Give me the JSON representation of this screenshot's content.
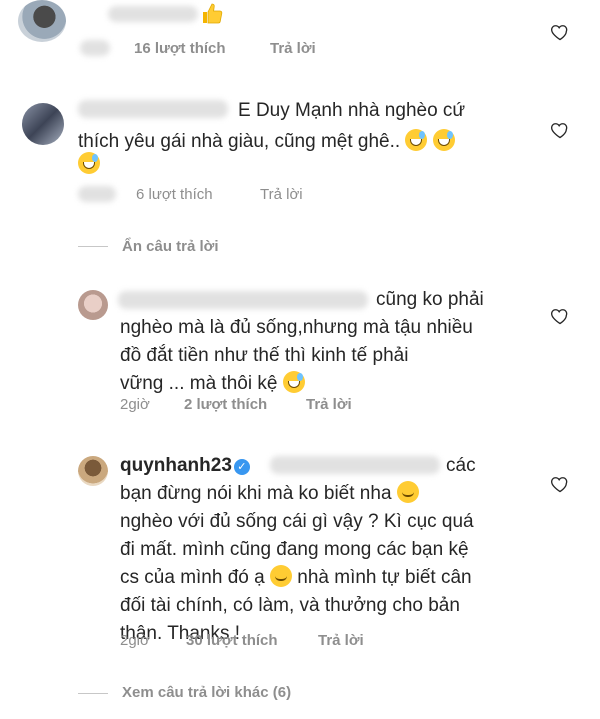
{
  "comments": [
    {
      "text": "",
      "likes": "16 lượt thích",
      "reply": "Trả lời"
    },
    {
      "text_line1": "E Duy Mạnh nhà nghèo cứ",
      "text_line2": "thích yêu gái nhà giàu, cũng mệt ghê..",
      "likes": "6 lượt thích",
      "reply": "Trả lời"
    }
  ],
  "hide_replies": "Ẩn câu trả lời",
  "replies": [
    {
      "line1": "cũng ko phải",
      "line2": "nghèo mà là đủ sống,nhưng mà tậu nhiều",
      "line3": "đồ đắt tiền như thế thì kinh tế phải",
      "line4": "vững ... mà thôi kệ",
      "time": "2giờ",
      "likes": "2 lượt thích",
      "reply": "Trả lời"
    },
    {
      "username": "quynhanh23",
      "line1": "các",
      "line2": "bạn đừng nói khi mà ko biết nha",
      "line3": "nghèo với đủ sống cái gì vậy ? Kì cục quá",
      "line4": "đi mất. mình cũng đang mong các bạn kệ",
      "line5": "cs của mình đó ạ",
      "line5b": "nhà mình tự biết cân",
      "line6": "đối tài chính, có làm, và thưởng cho bản",
      "line7": "thân. Thanks !",
      "time": "2giờ",
      "likes": "30 lượt thích",
      "reply": "Trả lời"
    }
  ],
  "more_replies": "Xem câu trả lời khác (6)",
  "icons": {
    "heart": "heart-outline-icon",
    "thumbs_up": "thumbs-up-emoji",
    "grin_sweat": "grinning-sweat-emoji",
    "rofl": "rolling-laughing-emoji",
    "relieved": "relieved-emoji",
    "verified": "verified-badge-icon"
  }
}
